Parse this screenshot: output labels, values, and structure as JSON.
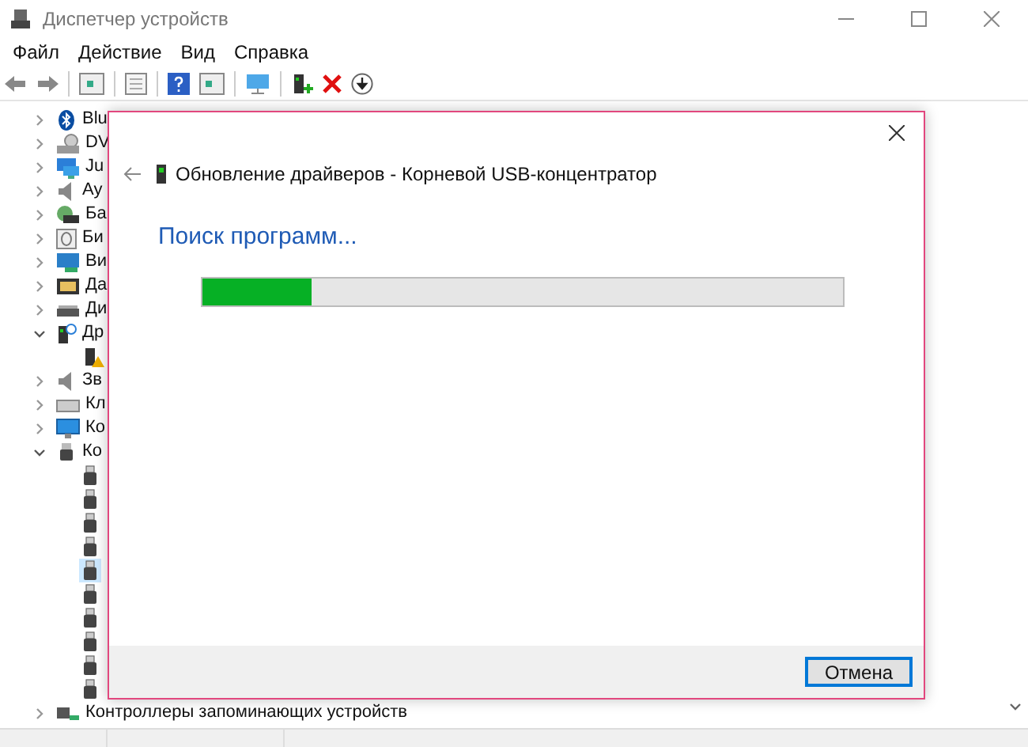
{
  "window": {
    "title": "Диспетчер устройств"
  },
  "menu": [
    "Файл",
    "Действие",
    "Вид",
    "Справка"
  ],
  "tree": [
    {
      "label": "Blu",
      "expanded": false
    },
    {
      "label": "DV",
      "expanded": false
    },
    {
      "label": "Ju",
      "expanded": false
    },
    {
      "label": "Ау",
      "expanded": false
    },
    {
      "label": "Ба",
      "expanded": false
    },
    {
      "label": "Би",
      "expanded": false
    },
    {
      "label": "Ви",
      "expanded": false
    },
    {
      "label": "Да",
      "expanded": false
    },
    {
      "label": "Ди",
      "expanded": false
    },
    {
      "label": "Др",
      "expanded": true,
      "children": [
        {
          "selected": false
        }
      ]
    },
    {
      "label": "Зв",
      "expanded": false
    },
    {
      "label": "Кл",
      "expanded": false
    },
    {
      "label": "Ко",
      "expanded": false
    },
    {
      "label": "Ко",
      "expanded": true,
      "children": [
        {
          "selected": false
        },
        {
          "selected": false
        },
        {
          "selected": false
        },
        {
          "selected": false
        },
        {
          "selected": true
        },
        {
          "selected": false
        },
        {
          "selected": false
        },
        {
          "selected": false
        },
        {
          "selected": false
        },
        {
          "selected": false
        }
      ]
    },
    {
      "label": "Контроллеры запоминающих устройств",
      "expanded": false
    }
  ],
  "dialog": {
    "title": "Обновление драйверов - Корневой USB-концентратор",
    "heading": "Поиск программ...",
    "progress": {
      "level": 0.17
    },
    "cancel_button": "Отмена"
  }
}
